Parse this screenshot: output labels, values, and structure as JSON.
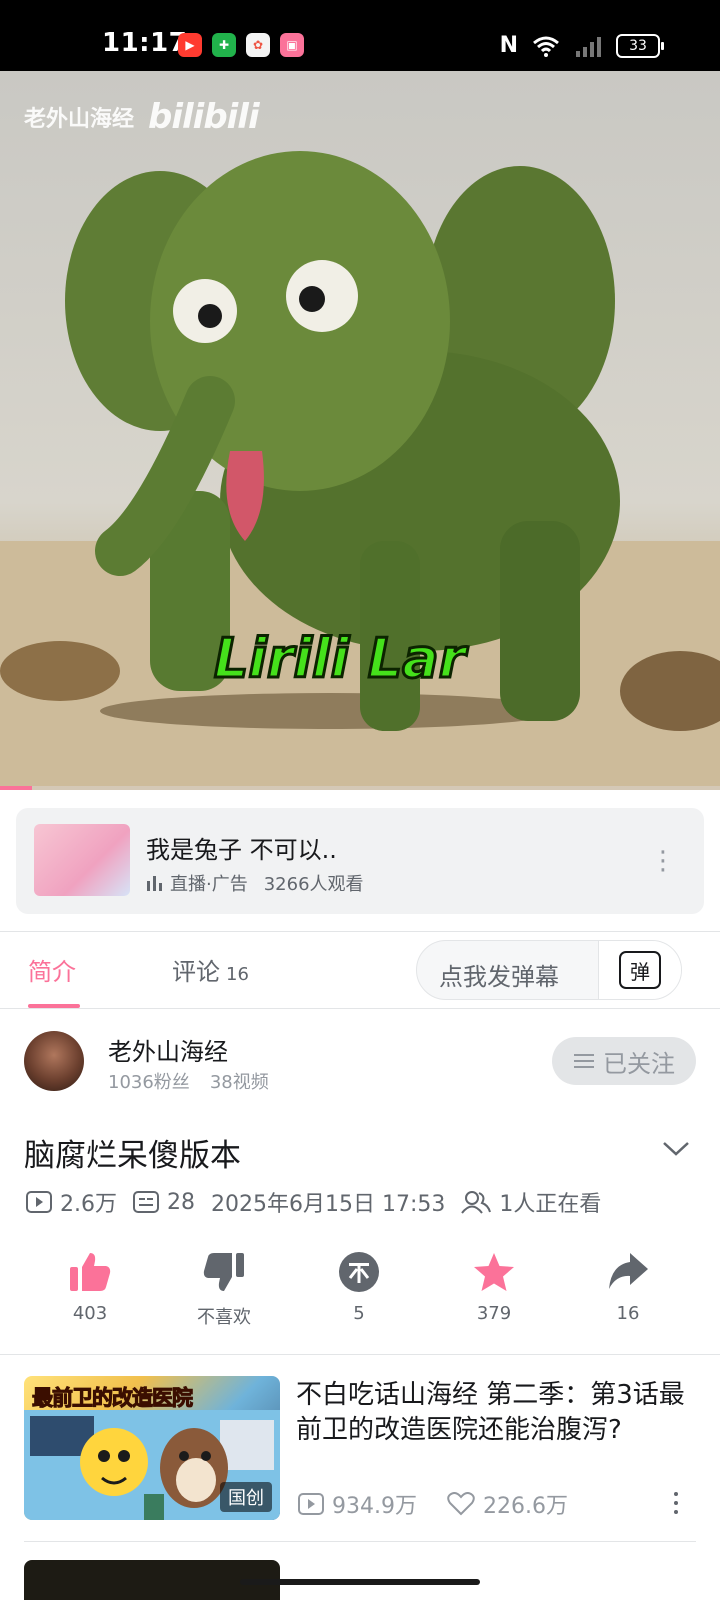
{
  "status_bar": {
    "time": "11:17",
    "battery": "33"
  },
  "video": {
    "watermark_channel": "老外山海经",
    "watermark_brand": "bilibili",
    "subtitle": "Lirili Lar",
    "progress_fraction": 0.044
  },
  "ad": {
    "title": "我是兔子 不可以..",
    "meta": "直播·广告",
    "viewers": "3266人观看"
  },
  "tabs": {
    "intro": "简介",
    "comment": "评论",
    "comment_count": "16"
  },
  "danmaku": {
    "placeholder": "点我发弹幕",
    "icon_text": "弹"
  },
  "uploader": {
    "name": "老外山海经",
    "fans": "1036粉丝",
    "videos": "38视频",
    "follow_label": "已关注"
  },
  "video_info": {
    "title": "脑腐烂呆傻版本",
    "views": "2.6万",
    "danmaku_count": "28",
    "date": "2025年6月15日 17:53",
    "watching": "1人正在看"
  },
  "actions": {
    "like": "403",
    "dislike": "不喜欢",
    "coin": "5",
    "favorite": "379",
    "share": "16"
  },
  "recommended": {
    "title": "不白吃话山海经 第二季：第3话最前卫的改造医院还能治腹泻?",
    "thumb_banner": "最前卫的改造医院",
    "badge": "国创",
    "views": "934.9万",
    "likes": "226.6万"
  },
  "colors": {
    "accent": "#fb7299",
    "text_secondary": "#61666d",
    "divider": "#e3e5e7"
  }
}
